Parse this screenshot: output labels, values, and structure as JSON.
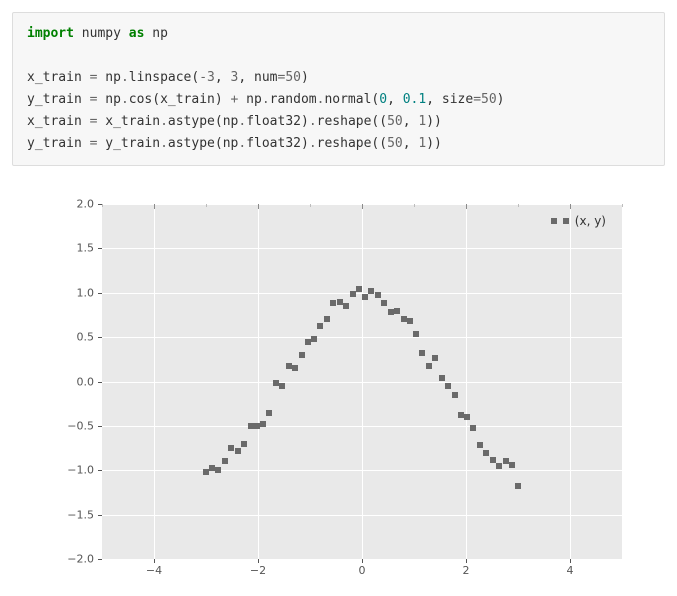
{
  "code": {
    "l1_import": "import",
    "l1_numpy": "numpy",
    "l1_as": "as",
    "l1_np": "np",
    "l2": "",
    "l3_a": "x_train ",
    "l3_eq": "=",
    "l3_b": " np",
    "l3_dot1": ".",
    "l3_c": "linspace(",
    "l3_n1": "-3",
    "l3_comma1": ", ",
    "l3_n2": "3",
    "l3_comma2": ", num",
    "l3_eq2": "=",
    "l3_n3": "50",
    "l3_close": ")",
    "l4_a": "y_train ",
    "l4_eq": "=",
    "l4_b": " np",
    "l4_dot1": ".",
    "l4_c": "cos(x_train) ",
    "l4_plus": "+",
    "l4_d": " np",
    "l4_dot2": ".",
    "l4_e": "random",
    "l4_dot3": ".",
    "l4_f": "normal(",
    "l4_n1": "0",
    "l4_comma1": ", ",
    "l4_n2": "0.1",
    "l4_comma2": ", size",
    "l4_eq2": "=",
    "l4_n3": "50",
    "l4_close": ")",
    "l5_a": "x_train ",
    "l5_eq": "=",
    "l5_b": " x_train",
    "l5_dot1": ".",
    "l5_c": "astype(np",
    "l5_dot2": ".",
    "l5_d": "float32)",
    "l5_dot3": ".",
    "l5_e": "reshape((",
    "l5_n1": "50",
    "l5_comma": ", ",
    "l5_n2": "1",
    "l5_close": "))",
    "l6_a": "y_train ",
    "l6_eq": "=",
    "l6_b": " y_train",
    "l6_dot1": ".",
    "l6_c": "astype(np",
    "l6_dot2": ".",
    "l6_d": "float32)",
    "l6_dot3": ".",
    "l6_e": "reshape((",
    "l6_n1": "50",
    "l6_comma": ", ",
    "l6_n2": "1",
    "l6_close": "))"
  },
  "chart": {
    "legend_label": "(x, y)",
    "y_ticks": [
      "2.0",
      "1.5",
      "1.0",
      "0.5",
      "0.0",
      "−0.5",
      "−1.0",
      "−1.5",
      "−2.0"
    ],
    "x_ticks": [
      "−4",
      "−2",
      "0",
      "2",
      "4"
    ]
  },
  "chart_data": {
    "type": "scatter",
    "title": "",
    "xlabel": "",
    "ylabel": "",
    "xlim": [
      -5,
      5
    ],
    "ylim": [
      -2,
      2
    ],
    "grid": true,
    "legend_position": "upper right",
    "series": [
      {
        "name": "(x, y)",
        "x": [
          -3.0,
          -2.88,
          -2.76,
          -2.63,
          -2.51,
          -2.39,
          -2.27,
          -2.14,
          -2.02,
          -1.9,
          -1.78,
          -1.65,
          -1.53,
          -1.41,
          -1.29,
          -1.16,
          -1.04,
          -0.92,
          -0.8,
          -0.67,
          -0.55,
          -0.43,
          -0.31,
          -0.18,
          -0.06,
          0.06,
          0.18,
          0.31,
          0.43,
          0.55,
          0.67,
          0.8,
          0.92,
          1.04,
          1.16,
          1.29,
          1.41,
          1.53,
          1.65,
          1.78,
          1.9,
          2.02,
          2.14,
          2.27,
          2.39,
          2.51,
          2.63,
          2.76,
          2.88,
          3.0
        ],
        "y": [
          -1.02,
          -0.98,
          -1.0,
          -0.9,
          -0.75,
          -0.78,
          -0.7,
          -0.5,
          -0.5,
          -0.48,
          -0.35,
          -0.02,
          -0.05,
          0.18,
          0.15,
          0.3,
          0.45,
          0.48,
          0.62,
          0.7,
          0.88,
          0.9,
          0.85,
          0.99,
          1.04,
          0.95,
          1.02,
          0.98,
          0.88,
          0.78,
          0.8,
          0.7,
          0.68,
          0.53,
          0.32,
          0.18,
          0.26,
          0.04,
          -0.05,
          -0.15,
          -0.38,
          -0.4,
          -0.52,
          -0.72,
          -0.8,
          -0.88,
          -0.95,
          -0.9,
          -0.94,
          -1.18
        ]
      }
    ]
  }
}
